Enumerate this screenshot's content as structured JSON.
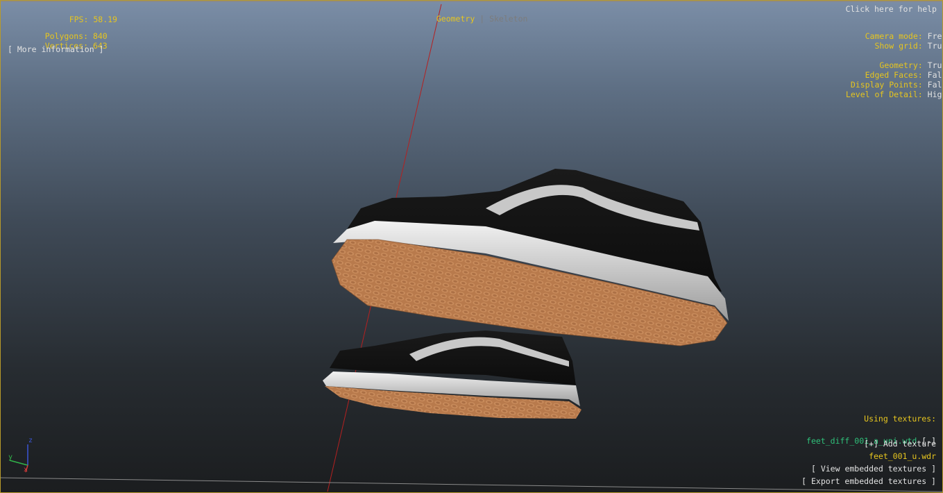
{
  "stats": {
    "fps_label": "FPS:",
    "fps_value": "58.19",
    "polygons_label": "Polygons:",
    "polygons_value": "840",
    "vertices_label": "Vertices:",
    "vertices_value": "643",
    "more_info": "[ More information ]"
  },
  "mode_tabs": {
    "geometry": "Geometry",
    "separator": "|",
    "skeleton": "Skeleton"
  },
  "help_link": "Click here for help",
  "settings": {
    "camera_mode_label": "Camera mode:",
    "camera_mode_value": "Free",
    "show_grid_label": "Show grid:",
    "show_grid_value": "True",
    "geometry_label": "Geometry:",
    "geometry_value": "True",
    "edged_faces_label": "Edged Faces:",
    "edged_faces_value": "False",
    "display_points_label": "Display Points:",
    "display_points_value": "False",
    "lod_label": "Level of Detail:",
    "lod_value": "High"
  },
  "textures": {
    "heading": "Using textures:",
    "texture_file": "feet_diff_001_a_uni.wtd",
    "remove": "[-]",
    "add": "[+] Add texture",
    "model_file": "feet_001_u.wdr",
    "view_embedded": "[ View embedded textures ]",
    "export_embedded": "[ Export embedded textures ]"
  },
  "axes": {
    "z": "z",
    "y": "y",
    "x": "x"
  },
  "colors": {
    "accent": "#e6c51f",
    "text": "#e2e2e2",
    "texture": "#2fc07a",
    "inactive": "#7c7c7c"
  }
}
